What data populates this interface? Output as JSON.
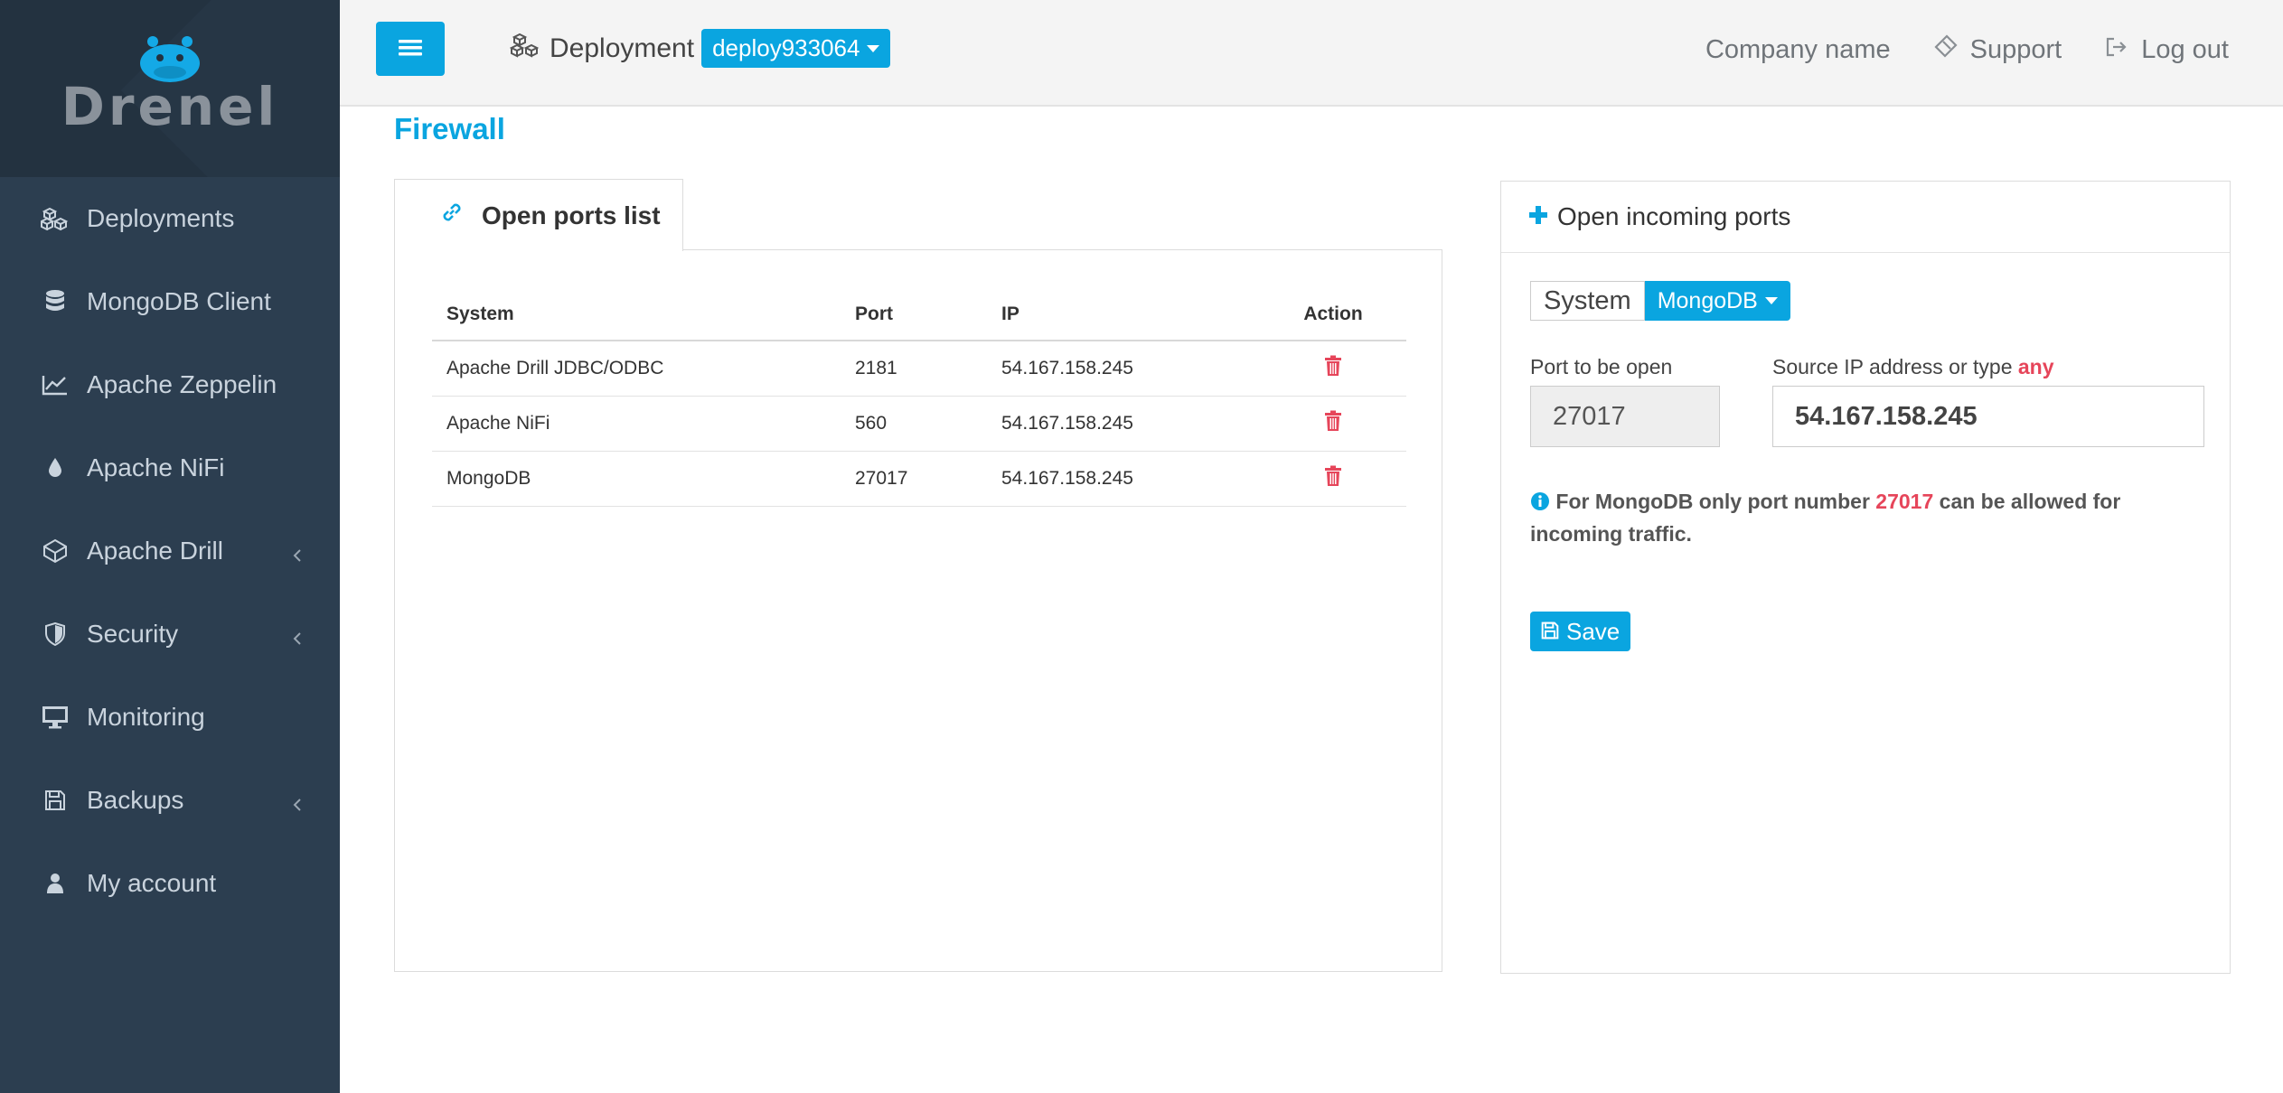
{
  "brand": {
    "name": "Drenel"
  },
  "sidebar": {
    "items": [
      {
        "label": "Deployments",
        "icon": "cubes-icon",
        "has_chevron": false
      },
      {
        "label": "MongoDB Client",
        "icon": "database-icon",
        "has_chevron": false
      },
      {
        "label": "Apache Zeppelin",
        "icon": "line-chart-icon",
        "has_chevron": false
      },
      {
        "label": "Apache NiFi",
        "icon": "tint-icon",
        "has_chevron": false
      },
      {
        "label": "Apache Drill",
        "icon": "drill-icon",
        "has_chevron": true
      },
      {
        "label": "Security",
        "icon": "shield-icon",
        "has_chevron": true
      },
      {
        "label": "Monitoring",
        "icon": "desktop-icon",
        "has_chevron": false
      },
      {
        "label": "Backups",
        "icon": "floppy-icon",
        "has_chevron": true
      },
      {
        "label": "My account",
        "icon": "user-icon",
        "has_chevron": false
      }
    ]
  },
  "header": {
    "deployment_label": "Deployment",
    "deployment_value": "deploy933064",
    "company": "Company name",
    "support": "Support",
    "logout": "Log out"
  },
  "page": {
    "title": "Firewall"
  },
  "ports_panel": {
    "tab_label": "Open ports list",
    "columns": [
      "System",
      "Port",
      "IP",
      "Action"
    ],
    "rows": [
      {
        "system": "Apache Drill JDBC/ODBC",
        "port": "2181",
        "ip": "54.167.158.245"
      },
      {
        "system": "Apache NiFi",
        "port": "560",
        "ip": "54.167.158.245"
      },
      {
        "system": "MongoDB",
        "port": "27017",
        "ip": "54.167.158.245"
      }
    ]
  },
  "open_panel": {
    "title": "Open incoming ports",
    "system_label": "System",
    "system_value": "MongoDB",
    "port_label": "Port to be open",
    "port_value": "27017",
    "ip_label": "Source IP address or type",
    "ip_label_any": "any",
    "ip_value": "54.167.158.245",
    "info_part1": "For MongoDB only port number",
    "info_number": "27017",
    "info_part2": "can be allowed for incoming traffic.",
    "save_label": "Save"
  },
  "colors": {
    "accent": "#0aa5e0",
    "danger": "#e6455a",
    "sidebar": "#2c3e50"
  }
}
